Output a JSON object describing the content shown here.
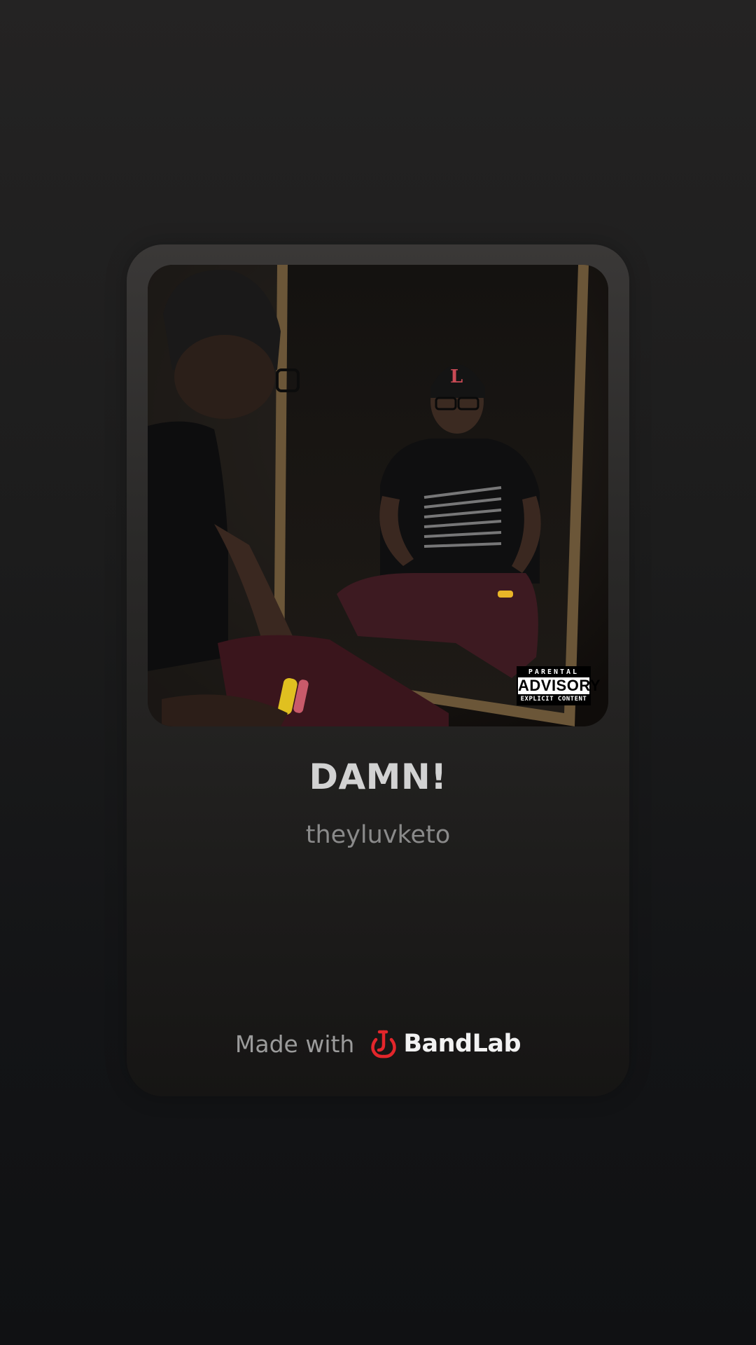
{
  "track": {
    "title": "DAMN!",
    "artist": "theyluvketo"
  },
  "cover_art": {
    "advisory_top": "PARENTAL",
    "advisory_middle": "ADVISORY",
    "advisory_bottom": "EXPLICIT CONTENT"
  },
  "footer": {
    "made_with": "Made with",
    "brand": "BandLab",
    "brand_color": "#e3262b"
  }
}
